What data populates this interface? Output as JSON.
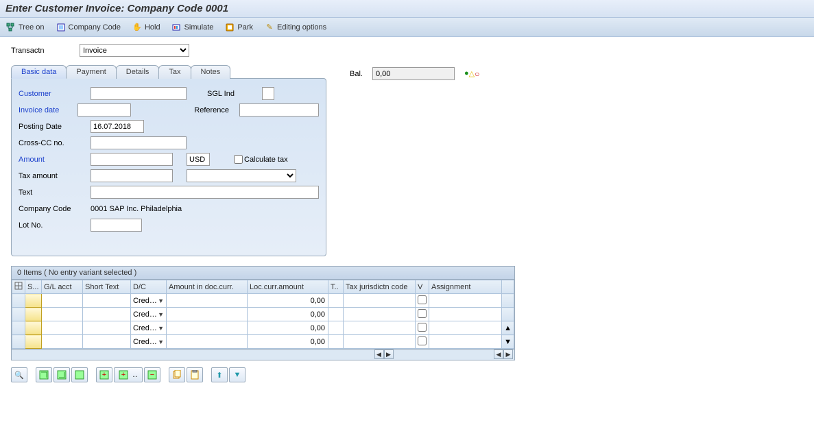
{
  "title": "Enter Customer Invoice: Company Code 0001",
  "toolbar": {
    "tree": "Tree on",
    "company": "Company Code",
    "hold": "Hold",
    "simulate": "Simulate",
    "park": "Park",
    "editing": "Editing options"
  },
  "transaction": {
    "label": "Transactn",
    "value": "Invoice"
  },
  "balance": {
    "label": "Bal.",
    "value": "0,00"
  },
  "tabs": [
    "Basic data",
    "Payment",
    "Details",
    "Tax",
    "Notes"
  ],
  "form": {
    "customer_label": "Customer",
    "customer_value": "",
    "sgl_label": "SGL Ind",
    "sgl_value": "",
    "invoice_date_label": "Invoice date",
    "invoice_date_value": "",
    "reference_label": "Reference",
    "reference_value": "",
    "posting_date_label": "Posting Date",
    "posting_date_value": "16.07.2018",
    "crosscc_label": "Cross-CC no.",
    "crosscc_value": "",
    "amount_label": "Amount",
    "amount_value": "",
    "currency_value": "USD",
    "calctax_label": "Calculate tax",
    "taxamount_label": "Tax amount",
    "taxamount_value": "",
    "taxcode_value": "",
    "text_label": "Text",
    "text_value": "",
    "company_label": "Company Code",
    "company_value": "0001 SAP Inc. Philadelphia",
    "lotno_label": "Lot No.",
    "lotno_value": ""
  },
  "items": {
    "header": "0 Items ( No entry variant selected )",
    "columns": [
      "S...",
      "G/L acct",
      "Short Text",
      "D/C",
      "Amount in doc.curr.",
      "Loc.curr.amount",
      "T..",
      "Tax jurisdictn code",
      "V",
      "Assignment"
    ],
    "dc_value": "Cred…",
    "loc_amount": "0,00"
  }
}
